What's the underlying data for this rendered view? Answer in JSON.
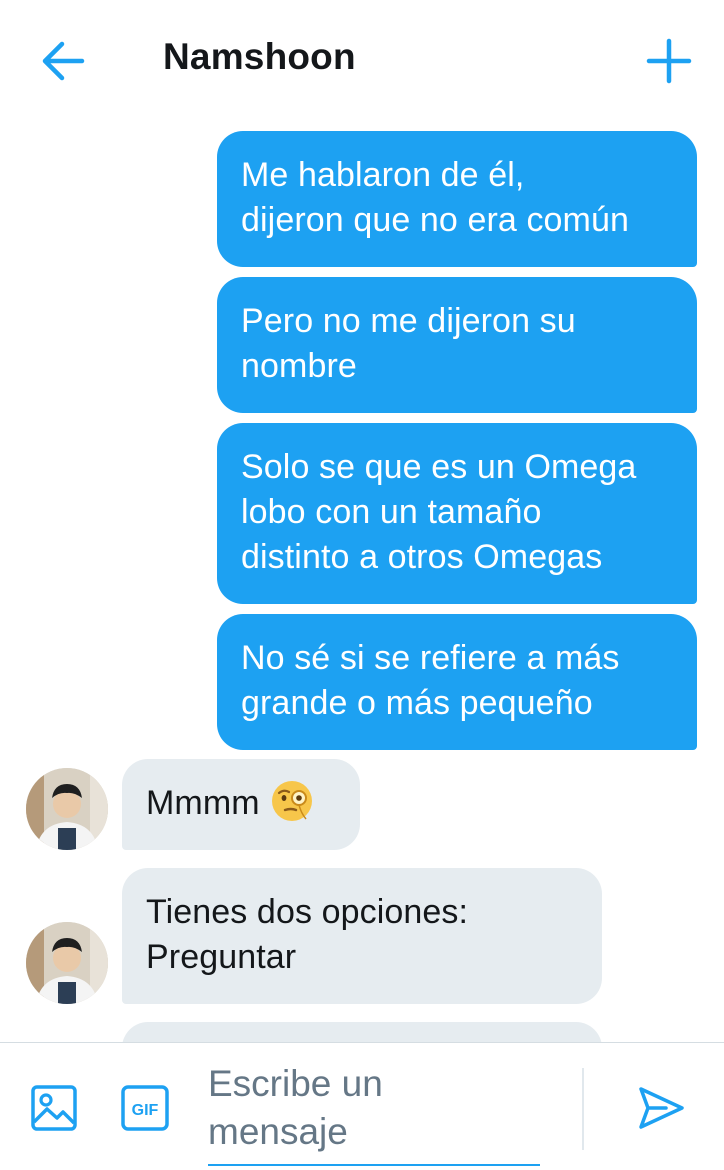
{
  "header": {
    "title": "Namshoon",
    "back_icon": "arrow-left-icon",
    "add_icon": "plus-icon"
  },
  "messages": [
    {
      "direction": "outgoing",
      "lines": [
        "Me hablaron de él,",
        "dijeron que no era común"
      ]
    },
    {
      "direction": "outgoing",
      "lines": [
        "Pero no me dijeron su",
        "nombre"
      ]
    },
    {
      "direction": "outgoing",
      "lines": [
        "Solo se que es un Omega",
        "lobo con un tamaño",
        "distinto a otros Omegas"
      ]
    },
    {
      "direction": "outgoing",
      "lines": [
        "No sé si se refiere a más",
        "grande o más pequeño"
      ]
    },
    {
      "direction": "incoming",
      "lines": [
        "Mmmm"
      ],
      "emoji": "face-with-monocle-icon"
    },
    {
      "direction": "incoming",
      "lines": [
        "Tienes dos opciones:",
        "Preguntar"
      ]
    }
  ],
  "composer": {
    "placeholder_lines": [
      "Escribe un",
      "mensaje"
    ],
    "image_icon": "image-icon",
    "gif_label": "GIF",
    "send_icon": "send-icon"
  },
  "colors": {
    "accent": "#1da1f2",
    "incoming_bubble": "#e6ecf0",
    "text_dark": "#14171a",
    "placeholder": "#657786"
  }
}
